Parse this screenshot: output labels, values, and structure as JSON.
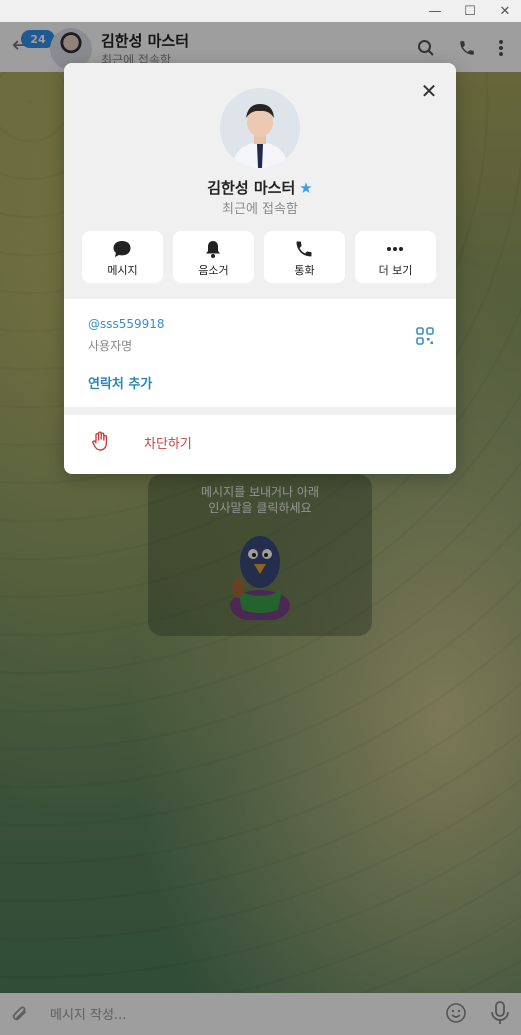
{
  "window": {
    "minimize_glyph": "—",
    "maximize_glyph": "☐",
    "close_glyph": "✕"
  },
  "header": {
    "unread_count": "24",
    "contact_name": "김한성 마스터",
    "status": "최근에 접속함",
    "icons": [
      "back-arrow-icon",
      "search-icon",
      "phone-icon",
      "more-vertical-icon"
    ]
  },
  "chat": {
    "empty_line1": "메시지를 보내거나 아래",
    "empty_line2": "인사말을 클릭하세요"
  },
  "composer": {
    "placeholder": "메시지 작성..."
  },
  "profile": {
    "name": "김한성 마스터",
    "status": "최근에 접속함",
    "actions": [
      {
        "label": "메시지",
        "icon": "message-icon"
      },
      {
        "label": "음소거",
        "icon": "bell-icon"
      },
      {
        "label": "통화",
        "icon": "phone-icon"
      },
      {
        "label": "더 보기",
        "icon": "more-horizontal-icon"
      }
    ],
    "username": "@sss559918",
    "username_caption": "사용자명",
    "add_contact": "연락처 추가",
    "block": "차단하기"
  },
  "colors": {
    "accent": "#3390ec",
    "link": "#3a8fc4",
    "danger": "#c94040",
    "star": "#3aa0e5"
  }
}
